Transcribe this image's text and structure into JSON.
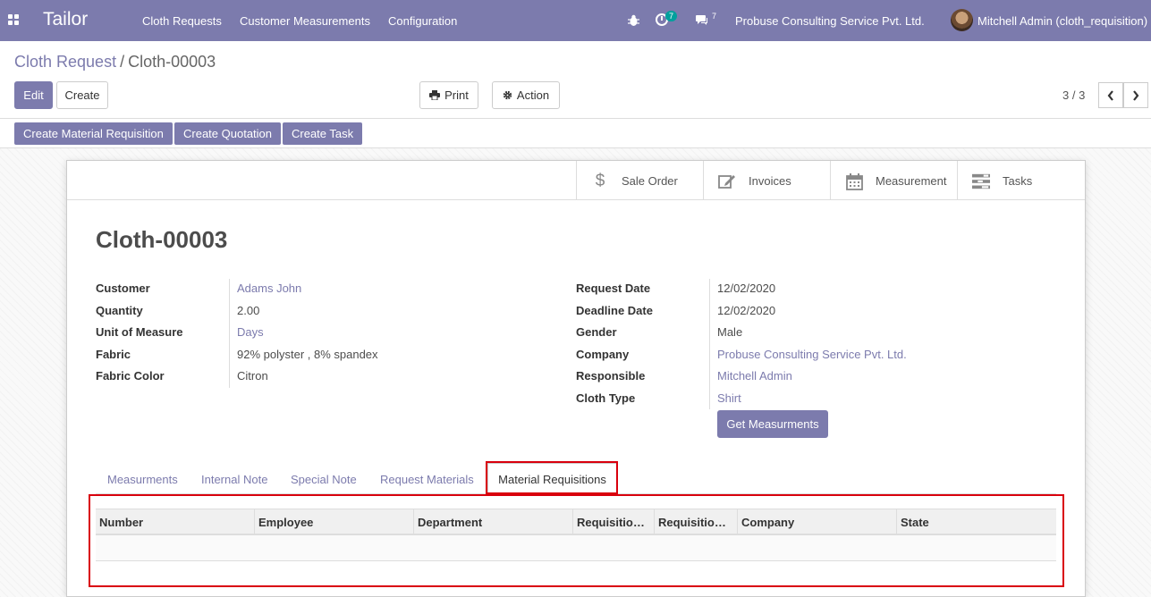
{
  "navbar": {
    "brand": "Tailor",
    "menu": [
      "Cloth Requests",
      "Customer Measurements",
      "Configuration"
    ],
    "activity_count": "7",
    "messages_count": "7",
    "company": "Probuse Consulting Service Pvt. Ltd.",
    "user": "Mitchell Admin (cloth_requisition)"
  },
  "breadcrumb": {
    "parent": "Cloth Request",
    "separator": "/",
    "current": "Cloth-00003"
  },
  "toolbar": {
    "edit": "Edit",
    "create": "Create",
    "print": "Print",
    "action": "Action"
  },
  "pager": {
    "text": "3 / 3"
  },
  "header_buttons": [
    "Create Material Requisition",
    "Create Quotation",
    "Create Task"
  ],
  "smart_buttons": [
    {
      "label": "Sale Order",
      "icon": "dollar-icon"
    },
    {
      "label": "Invoices",
      "icon": "edit-icon"
    },
    {
      "label": "Measurement",
      "icon": "calendar-icon"
    },
    {
      "label": "Tasks",
      "icon": "tasks-icon"
    }
  ],
  "record": {
    "name": "Cloth-00003"
  },
  "left_fields": [
    {
      "label": "Customer",
      "value": "Adams John",
      "link": true
    },
    {
      "label": "Quantity",
      "value": "2.00",
      "link": false
    },
    {
      "label": "Unit of Measure",
      "value": "Days",
      "link": true
    },
    {
      "label": "Fabric",
      "value": "92% polyster , 8% spandex",
      "link": false
    },
    {
      "label": "Fabric Color",
      "value": "Citron",
      "link": false
    }
  ],
  "right_fields": [
    {
      "label": "Request Date",
      "value": "12/02/2020",
      "link": false
    },
    {
      "label": "Deadline Date",
      "value": "12/02/2020",
      "link": false
    },
    {
      "label": "Gender",
      "value": "Male",
      "link": false
    },
    {
      "label": "Company",
      "value": "Probuse Consulting Service Pvt. Ltd.",
      "link": true
    },
    {
      "label": "Responsible",
      "value": "Mitchell Admin",
      "link": true
    },
    {
      "label": "Cloth Type",
      "value": "Shirt",
      "link": true
    }
  ],
  "get_measurements": "Get Measurments",
  "tabs": [
    "Measurments",
    "Internal Note",
    "Special Note",
    "Request Materials",
    "Material Requisitions"
  ],
  "table": {
    "columns": [
      "Number",
      "Employee",
      "Department",
      "Requisitio…",
      "Requisitio…",
      "Company",
      "State"
    ]
  },
  "colors": {
    "brand": "#7c7bad",
    "highlight": "#d9000d"
  }
}
